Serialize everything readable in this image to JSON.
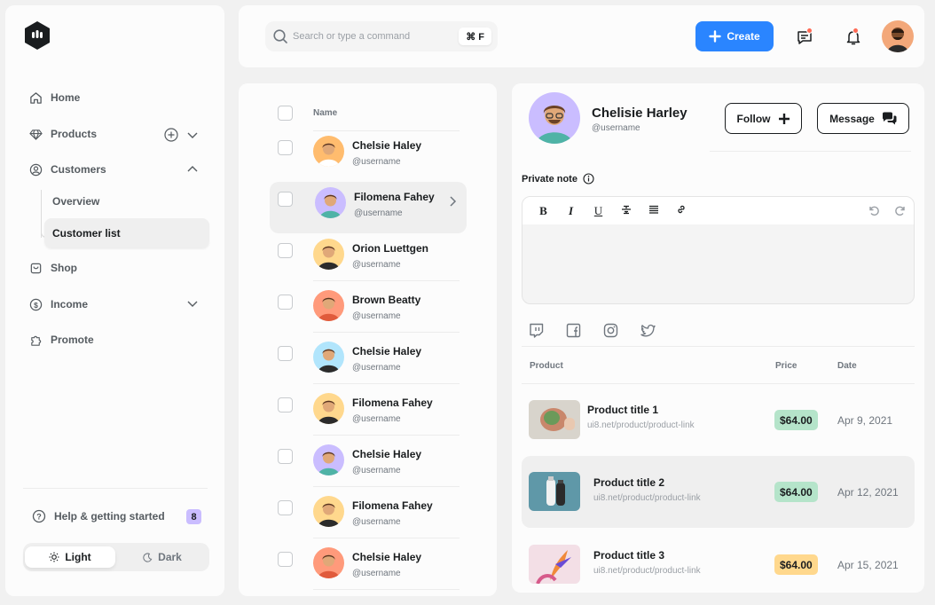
{
  "sidebar": {
    "nav": [
      {
        "label": "Home",
        "icon": "home-icon"
      },
      {
        "label": "Products",
        "icon": "diamond-icon"
      },
      {
        "label": "Customers",
        "icon": "user-circle-icon"
      },
      {
        "label": "Shop",
        "icon": "bag-icon"
      },
      {
        "label": "Income",
        "icon": "dollar-circle-icon"
      },
      {
        "label": "Promote",
        "icon": "puzzle-icon"
      }
    ],
    "customers_sub": [
      "Overview",
      "Customer list"
    ],
    "help_label": "Help & getting started",
    "help_count": "8",
    "theme_light": "Light",
    "theme_dark": "Dark"
  },
  "topbar": {
    "search_placeholder": "Search or type a command",
    "shortcut": "⌘ F",
    "create_label": "Create"
  },
  "list": {
    "header": "Name",
    "customers": [
      {
        "name": "Chelsie Haley",
        "username": "@username",
        "avatar_bg": "#ffbc6e"
      },
      {
        "name": "Filomena Fahey",
        "username": "@username",
        "avatar_bg": "#cabdff"
      },
      {
        "name": "Orion Luettgen",
        "username": "@username",
        "avatar_bg": "#ffd88d"
      },
      {
        "name": "Brown Beatty",
        "username": "@username",
        "avatar_bg": "#ff9a7b"
      },
      {
        "name": "Chelsie Haley",
        "username": "@username",
        "avatar_bg": "#b1e5fc"
      },
      {
        "name": "Filomena Fahey",
        "username": "@username",
        "avatar_bg": "#ffd88d"
      },
      {
        "name": "Chelsie Haley",
        "username": "@username",
        "avatar_bg": "#cabdff"
      },
      {
        "name": "Filomena Fahey",
        "username": "@username",
        "avatar_bg": "#ffd88d"
      },
      {
        "name": "Chelsie Haley",
        "username": "@username",
        "avatar_bg": "#ff9a7b"
      }
    ]
  },
  "detail": {
    "name": "Chelisie Harley",
    "username": "@username",
    "follow_label": "Follow",
    "message_label": "Message",
    "note_label": "Private note",
    "toolbar": [
      "B",
      "I",
      "U"
    ],
    "table_headers": {
      "product": "Product",
      "price": "Price",
      "date": "Date"
    },
    "products": [
      {
        "title": "Product title 1",
        "link": "ui8.net/product/product-link",
        "price": "$64.00",
        "date": "Apr 9, 2021",
        "price_bg": "#b5e4ca"
      },
      {
        "title": "Product title 2",
        "link": "ui8.net/product/product-link",
        "price": "$64.00",
        "date": "Apr 12, 2021",
        "price_bg": "#b5e4ca"
      },
      {
        "title": "Product title 3",
        "link": "ui8.net/product/product-link",
        "price": "$64.00",
        "date": "Apr 15, 2021",
        "price_bg": "#ffd88d"
      }
    ]
  },
  "colors": {
    "accent": "#2a85ff",
    "notify": "#ff6a55",
    "purple": "#cabdff"
  }
}
